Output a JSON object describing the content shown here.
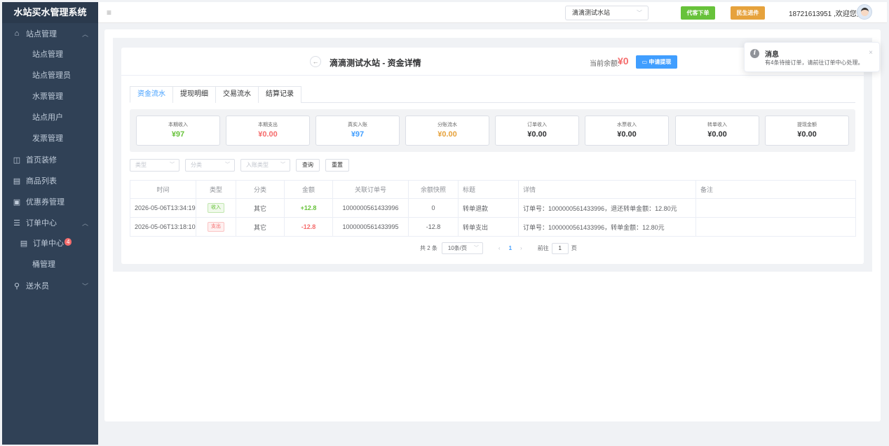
{
  "app": {
    "title": "水站买水管理系统"
  },
  "sidebar": {
    "groups": [
      {
        "label": "站点管理",
        "icon": "home-icon",
        "children": [
          "站点管理",
          "站点管理员",
          "水票管理",
          "站点用户",
          "发票管理"
        ]
      },
      {
        "label": "首页装修",
        "icon": "cube-icon"
      },
      {
        "label": "商品列表",
        "icon": "document-icon"
      },
      {
        "label": "优惠券管理",
        "icon": "coupon-icon"
      },
      {
        "label": "订单中心",
        "icon": "list-icon",
        "children": [
          "订单中心",
          "桶管理"
        ],
        "badge": "4"
      },
      {
        "label": "送水员",
        "icon": "location-icon"
      }
    ]
  },
  "header": {
    "station": "滴滴测试水站",
    "btn_proxy_order": "代客下单",
    "btn_minsheng": "民生进件",
    "user_text": "18721613951 ,欢迎您登录"
  },
  "page": {
    "title": "滴滴测试水站 - 资金详情",
    "balance_label": "当前余额:",
    "balance_value": "¥0",
    "withdraw_btn": "申请提现",
    "tabs": [
      "资金流水",
      "提现明细",
      "交易流水",
      "结算记录"
    ],
    "active_tab": 0
  },
  "stats": [
    {
      "label": "本期收入",
      "value": "¥97",
      "color": "#67c23a"
    },
    {
      "label": "本期支出",
      "value": "¥0.00",
      "color": "#f56c6c"
    },
    {
      "label": "真实入账",
      "value": "¥97",
      "color": "#409eff"
    },
    {
      "label": "分账流水",
      "value": "¥0.00",
      "color": "#e6a23c"
    },
    {
      "label": "订单收入",
      "value": "¥0.00",
      "color": "#303133"
    },
    {
      "label": "水票收入",
      "value": "¥0.00",
      "color": "#303133"
    },
    {
      "label": "转单收入",
      "value": "¥0.00",
      "color": "#303133"
    },
    {
      "label": "提现金额",
      "value": "¥0.00",
      "color": "#303133"
    }
  ],
  "filters": {
    "type_placeholder": "类型",
    "category_placeholder": "分类",
    "account_type_placeholder": "入账类型",
    "query_btn": "查询",
    "reset_btn": "重置"
  },
  "table": {
    "headers": [
      "时间",
      "类型",
      "分类",
      "金额",
      "关联订单号",
      "余额快照",
      "标题",
      "详情",
      "备注"
    ],
    "rows": [
      {
        "time": "2026-05-06T13:34:19",
        "type": "收入",
        "type_kind": "in",
        "category": "其它",
        "amount": "+12.8",
        "order_no": "1000000561433996",
        "balance": "0",
        "title": "转单退款",
        "detail": "订单号：1000000561433996，退还转单金额：12.80元",
        "remark": ""
      },
      {
        "time": "2026-05-06T13:18:10",
        "type": "支出",
        "type_kind": "out",
        "category": "其它",
        "amount": "-12.8",
        "order_no": "1000000561433995",
        "balance": "-12.8",
        "title": "转单支出",
        "detail": "订单号：1000000561433996，转单金额：12.80元",
        "remark": ""
      }
    ]
  },
  "pager": {
    "total_text": "共 2 条",
    "page_size": "10条/页",
    "current": "1",
    "goto_label": "前往",
    "goto_value": "1",
    "page_unit": "页"
  },
  "notification": {
    "title": "消息",
    "message": "有4条待接订单，请前往订单中心处理。"
  }
}
